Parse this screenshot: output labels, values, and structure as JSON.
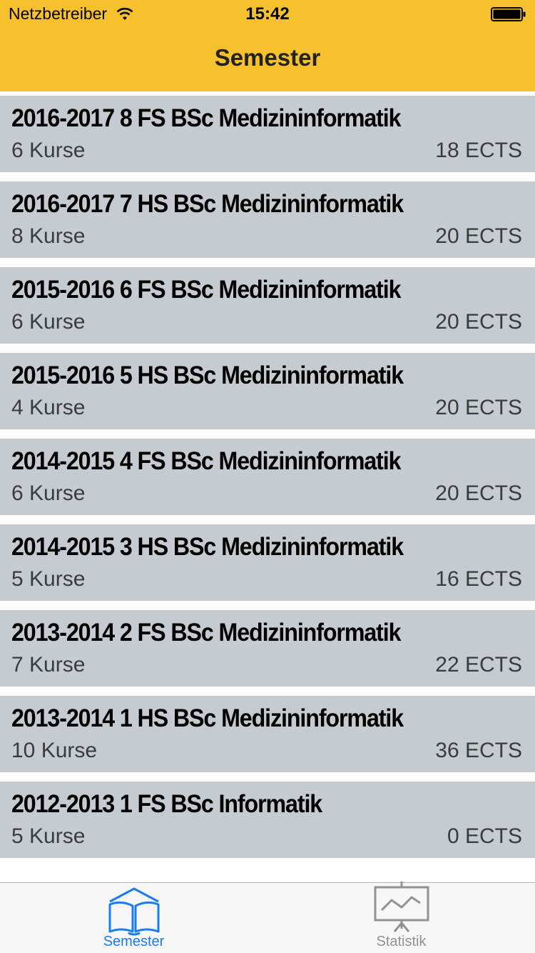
{
  "status_bar": {
    "carrier": "Netzbetreiber",
    "time": "15:42",
    "wifi_icon": "wifi-icon",
    "battery_icon": "battery-icon"
  },
  "nav": {
    "title": "Semester"
  },
  "colors": {
    "accent_yellow": "#f7c12e",
    "row_bg": "#c6cbd1",
    "tab_active": "#1a7cf5",
    "tab_inactive": "#929292"
  },
  "semesters": [
    {
      "title": "2016-2017 8 FS BSc Medizininformatik",
      "courses": "6 Kurse",
      "ects": "18 ECTS"
    },
    {
      "title": "2016-2017 7 HS BSc Medizininformatik",
      "courses": "8 Kurse",
      "ects": "20 ECTS"
    },
    {
      "title": "2015-2016 6 FS BSc Medizininformatik",
      "courses": "6 Kurse",
      "ects": "20 ECTS"
    },
    {
      "title": "2015-2016 5 HS BSc Medizininformatik",
      "courses": "4 Kurse",
      "ects": "20 ECTS"
    },
    {
      "title": "2014-2015 4 FS BSc Medizininformatik",
      "courses": "6 Kurse",
      "ects": "20 ECTS"
    },
    {
      "title": "2014-2015 3 HS BSc Medizininformatik",
      "courses": "5 Kurse",
      "ects": "16 ECTS"
    },
    {
      "title": "2013-2014 2 FS BSc Medizininformatik",
      "courses": "7 Kurse",
      "ects": "22 ECTS"
    },
    {
      "title": "2013-2014 1 HS BSc Medizininformatik",
      "courses": "10 Kurse",
      "ects": "36 ECTS"
    },
    {
      "title": "2012-2013 1 FS BSc Informatik",
      "courses": "5 Kurse",
      "ects": "0 ECTS"
    }
  ],
  "tabs": [
    {
      "label": "Semester",
      "icon": "book-icon",
      "active": true
    },
    {
      "label": "Statistik",
      "icon": "chart-board-icon",
      "active": false
    }
  ]
}
